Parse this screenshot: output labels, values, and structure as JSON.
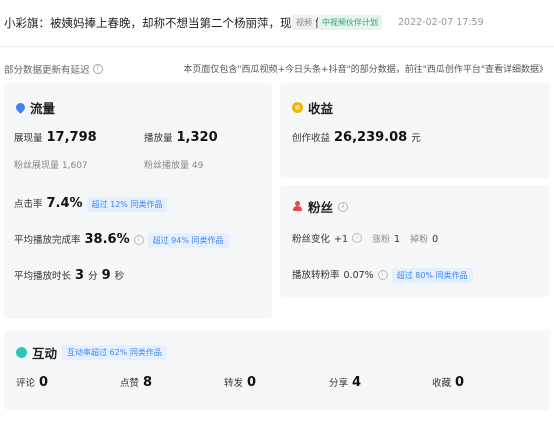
{
  "header": {
    "title": "小彩旗：被姨妈捧上春晚，却称不想当第二个杨丽萍，现状如何？",
    "tag_video": "视频",
    "tag_plan": "中视频伙伴计划",
    "date": "2022-02-07 17:59"
  },
  "notes": {
    "delay": "部分数据更新有延迟",
    "scope": "本页面仅包含\"西瓜视频+今日头条+抖音\"的部分数据，前往\"西瓜创作平台\"查看详细数据》"
  },
  "traffic": {
    "title": "流量",
    "impressions_label": "展现量",
    "impressions_value": "17,798",
    "plays_label": "播放量",
    "plays_value": "1,320",
    "fan_impressions_label": "粉丝展现量",
    "fan_impressions_value": "1,607",
    "fan_plays_label": "粉丝播放量",
    "fan_plays_value": "49",
    "ctr_label": "点击率",
    "ctr_value": "7.4%",
    "ctr_rank": "超过 12% 同类作品",
    "completion_label": "平均播放完成率",
    "completion_value": "38.6%",
    "completion_rank": "超过 94% 同类作品",
    "duration_label": "平均播放时长",
    "duration_min": "3",
    "duration_min_unit": "分",
    "duration_sec": "9",
    "duration_sec_unit": "秒"
  },
  "income": {
    "title": "收益",
    "label": "创作收益",
    "value": "26,239.08",
    "unit": "元"
  },
  "fans": {
    "title": "粉丝",
    "change_label": "粉丝变化",
    "change_value": "+1",
    "gain_label": "涨粉",
    "gain_value": "1",
    "loss_label": "掉粉",
    "loss_value": "0",
    "conversion_label": "播放转粉率",
    "conversion_value": "0.07%",
    "conversion_rank": "超过 80% 同类作品"
  },
  "interact": {
    "title": "互动",
    "rank": "互动率超过 62% 同类作品",
    "items": [
      {
        "label": "评论",
        "value": "0"
      },
      {
        "label": "点赞",
        "value": "8"
      },
      {
        "label": "转发",
        "value": "0"
      },
      {
        "label": "分享",
        "value": "4"
      },
      {
        "label": "收藏",
        "value": "0"
      }
    ]
  },
  "colors": {
    "accent_blue": "#3a86f7",
    "income_gold": "#f5b400",
    "fans_red": "#e8484a",
    "interact_teal": "#2ec6b8",
    "plan_green": "#2aa567"
  },
  "icons": [
    "drop-icon",
    "coin-icon",
    "person-icon",
    "bubble-icon",
    "help-icon",
    "info-icon"
  ]
}
